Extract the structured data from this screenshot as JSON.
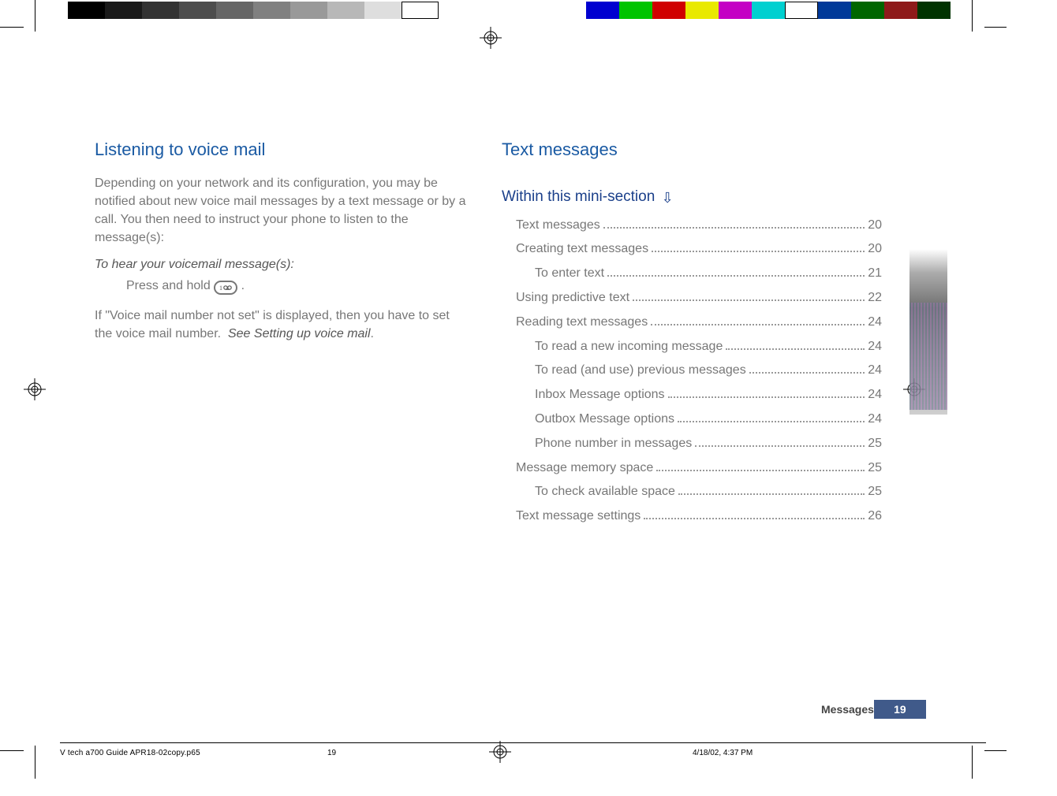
{
  "print_bars": {
    "grays": [
      "#000000",
      "#1a1a1a",
      "#333333",
      "#4d4d4d",
      "#666666",
      "#808080",
      "#999999",
      "#b8b8b8",
      "#dedede",
      "#ffffff"
    ],
    "colors": [
      "#0000d0",
      "#00c400",
      "#d00000",
      "#e9e900",
      "#c400c4",
      "#00d0d0",
      "#ffffff",
      "#003999",
      "#006600",
      "#8e1a1a",
      "#003300"
    ]
  },
  "left": {
    "heading": "Listening to voice mail",
    "para1": "Depending on your network and its configuration, you may be notified about new voice mail messages by a text message or by a call. You then need to instruct your phone to listen to the message(s):",
    "subhead": "To hear your voicemail message(s):",
    "step_prefix": "Press and hold",
    "step_suffix": ".",
    "key_label": "1-voicemail-key",
    "para2_a": "If \"Voice mail number not set\" is displayed, then you have to set the voice mail number. ",
    "para2_b": "See Setting up voice mail",
    "para2_c": "."
  },
  "right": {
    "heading": "Text messages",
    "mini_heading": "Within this mini-section",
    "arrow": "⇩",
    "toc": [
      {
        "label": "Text messages",
        "page": "20",
        "indent": 0
      },
      {
        "label": "Creating text messages",
        "page": "20",
        "indent": 0
      },
      {
        "label": "To enter text",
        "page": "21",
        "indent": 1
      },
      {
        "label": "Using predictive text",
        "page": "22",
        "indent": 0
      },
      {
        "label": "Reading text messages",
        "page": "24",
        "indent": 0
      },
      {
        "label": "To read a new incoming message",
        "page": "24",
        "indent": 1
      },
      {
        "label": "To read (and use) previous messages",
        "page": "24",
        "indent": 1
      },
      {
        "label": "Inbox Message options",
        "page": "24",
        "indent": 1
      },
      {
        "label": "Outbox Message options",
        "page": "24",
        "indent": 1
      },
      {
        "label": "Phone number in messages",
        "page": "25",
        "indent": 1
      },
      {
        "label": "Message memory space",
        "page": "25",
        "indent": 0
      },
      {
        "label": "To check available space",
        "page": "25",
        "indent": 1
      },
      {
        "label": "Text message settings",
        "page": "26",
        "indent": 0
      }
    ]
  },
  "footer": {
    "section": "Messages",
    "page": "19"
  },
  "meta": {
    "file": "V tech a700 Guide APR18-02copy.p65",
    "sheet": "19",
    "timestamp": "4/18/02, 4:37 PM"
  }
}
